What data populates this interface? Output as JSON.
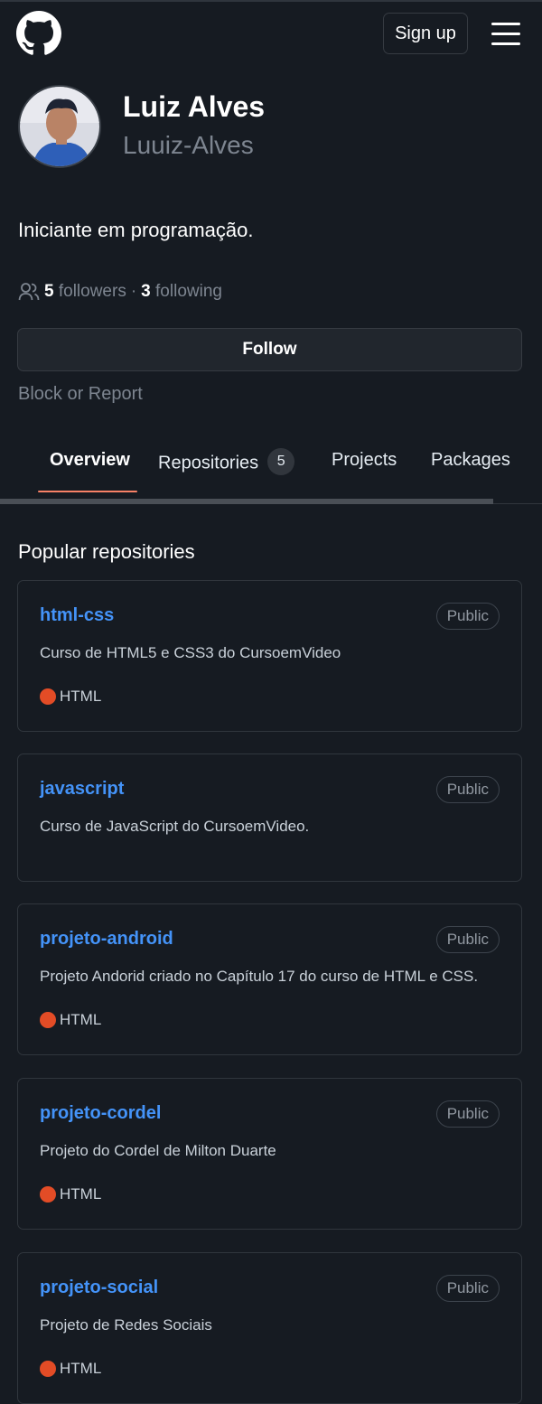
{
  "header": {
    "signup_label": "Sign up"
  },
  "profile": {
    "name": "Luiz Alves",
    "username": "Luuiz-Alves",
    "bio": "Iniciante em programação.",
    "followers_count": "5",
    "followers_label": "followers",
    "separator": "·",
    "following_count": "3",
    "following_label": "following",
    "follow_label": "Follow",
    "block_report_label": "Block or Report"
  },
  "tabs": [
    {
      "label": "Overview",
      "selected": true
    },
    {
      "label": "Repositories",
      "counter": "5"
    },
    {
      "label": "Projects"
    },
    {
      "label": "Packages"
    }
  ],
  "popular": {
    "title": "Popular repositories",
    "repos": [
      {
        "name": "html-css",
        "visibility": "Public",
        "description": "Curso de HTML5 e CSS3 do CursoemVideo",
        "language": "HTML"
      },
      {
        "name": "javascript",
        "visibility": "Public",
        "description": "Curso de JavaScript do CursoemVideo.",
        "language": ""
      },
      {
        "name": "projeto-android",
        "visibility": "Public",
        "description": "Projeto Andorid criado no Capítulo 17 do curso de HTML e CSS.",
        "language": "HTML"
      },
      {
        "name": "projeto-cordel",
        "visibility": "Public",
        "description": "Projeto do Cordel de Milton Duarte",
        "language": "HTML"
      },
      {
        "name": "projeto-social",
        "visibility": "Public",
        "description": "Projeto de Redes Sociais",
        "language": "HTML"
      }
    ]
  },
  "colors": {
    "background": "#161b22",
    "link": "#4493f8",
    "html_language": "#e34c26",
    "tab_underline": "#f78166"
  },
  "icons": [
    "github-logo-icon",
    "hamburger-menu-icon",
    "people-icon"
  ]
}
